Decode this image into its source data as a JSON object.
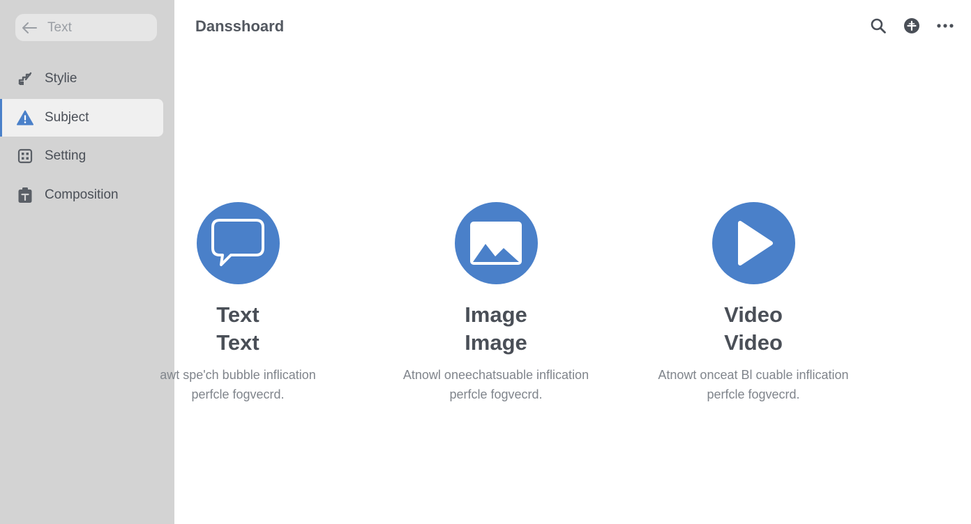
{
  "sidebar": {
    "back_field": {
      "label": "Text"
    },
    "items": [
      {
        "label": "Stylie",
        "icon": "brush-icon"
      },
      {
        "label": "Subject",
        "icon": "alert-icon",
        "active": true
      },
      {
        "label": "Setting",
        "icon": "grid-icon"
      },
      {
        "label": "Composition",
        "icon": "clipboard-icon"
      }
    ]
  },
  "header": {
    "title": "Dansshoard",
    "actions": [
      "search-icon",
      "add-circle-icon",
      "more-icon"
    ]
  },
  "cards": [
    {
      "icon": "speech-bubble-icon",
      "title_line1": "Text",
      "title_line2": "Text",
      "desc_line1": "awt spe'ch bubble inflication",
      "desc_line2": "perfcle fogvecrd."
    },
    {
      "icon": "image-icon",
      "title_line1": "Image",
      "title_line2": "Image",
      "desc_line1": "Atnowl oneechatsuable inflication",
      "desc_line2": "perfcle fogvecrd."
    },
    {
      "icon": "play-icon",
      "title_line1": "Video",
      "title_line2": "Video",
      "desc_line1": "Atnowt onceat Bl cuable inflication",
      "desc_line2": "perfcle fogvecrd."
    }
  ],
  "colors": {
    "accent": "#4a80c9",
    "sidebar_bg": "#d3d3d3",
    "active_item_bg": "#f0f0f0",
    "text": "#4a4f57",
    "muted_text": "#80858c"
  }
}
